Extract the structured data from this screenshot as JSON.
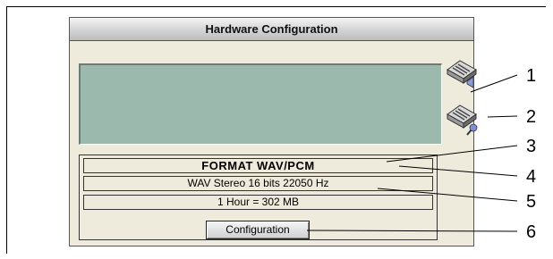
{
  "window": {
    "title": "Hardware Configuration"
  },
  "toolbar": {
    "button1_icon": "mixer-playback-icon",
    "button2_icon": "mixer-record-icon"
  },
  "info": {
    "format": "FORMAT WAV/PCM",
    "details": "WAV Stereo 16 bits 22050 Hz",
    "size": "1 Hour =  302 MB"
  },
  "buttons": {
    "configuration": "Configuration"
  },
  "callouts": [
    "1",
    "2",
    "3",
    "4",
    "5",
    "6"
  ],
  "colors": {
    "display": "#9bbaad",
    "window_bg": "#efebdc"
  }
}
